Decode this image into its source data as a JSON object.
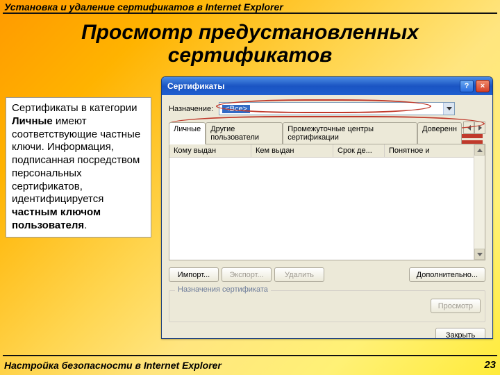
{
  "slide": {
    "topline": "Установка и удаление сертификатов в Internet Explorer",
    "title": "Просмотр предустановленных сертификатов",
    "footer": "Настройка безопасности в Internet Explorer",
    "page": "23"
  },
  "sidebox": {
    "t1": "Сертификаты в категории ",
    "bold1": "Личные",
    "t2": " имеют соответствующие частные ключи. Информация, подписанная посредством персональных сертификатов, идентифицируется ",
    "bold2": "частным ключом пользователя",
    "t3": "."
  },
  "dialog": {
    "title": "Сертификаты",
    "purpose_label": "Назначение:",
    "purpose_value": "<Все>",
    "tabs": [
      "Личные",
      "Другие пользователи",
      "Промежуточные центры сертификации",
      "Доверенн"
    ],
    "columns": [
      "Кому выдан",
      "Кем выдан",
      "Срок де...",
      "Понятное и"
    ],
    "buttons": {
      "import": "Импорт...",
      "export": "Экспорт...",
      "remove": "Удалить",
      "advanced": "Дополнительно...",
      "view": "Просмотр",
      "close": "Закрыть"
    },
    "group_label": "Назначения сертификата",
    "help_icon": "?",
    "close_icon": "×"
  }
}
